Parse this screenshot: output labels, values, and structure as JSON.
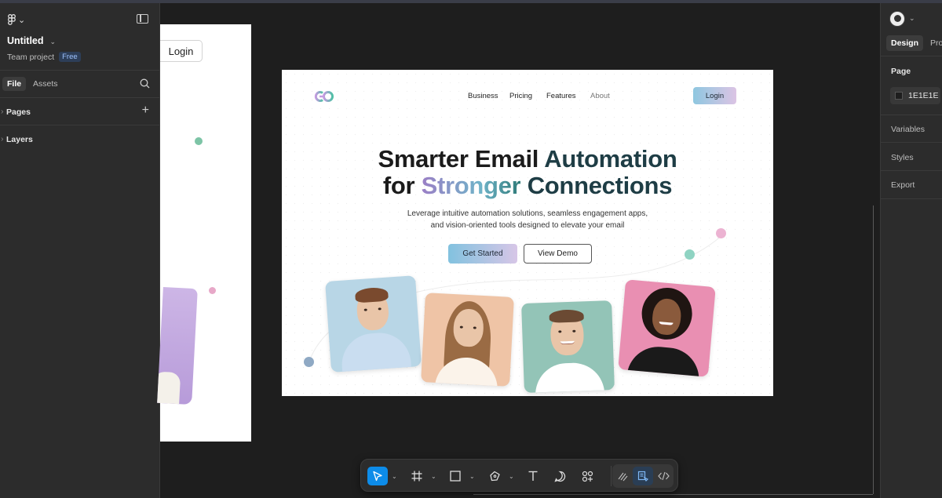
{
  "app": {
    "file_title": "Untitled",
    "team": "Team project",
    "plan_badge": "Free",
    "tabs": {
      "file": "File",
      "assets": "Assets"
    },
    "sections": {
      "pages": "Pages",
      "layers": "Layers"
    }
  },
  "right_panel": {
    "tabs": {
      "design": "Design",
      "prototype": "Pro"
    },
    "page_label": "Page",
    "page_color_hex": "1E1E1E",
    "page_color": "#1e1e1e",
    "variables": "Variables",
    "styles": "Styles",
    "export": "Export"
  },
  "canvas": {
    "left_frame_login": "Login",
    "landing": {
      "nav": [
        "Business",
        "Pricing",
        "Features",
        "About"
      ],
      "login": "Login",
      "headline_1a": "Smarter Email ",
      "headline_1b": "Automation",
      "headline_2a": "for ",
      "headline_2b": "Stronger",
      "headline_2c": " Connections",
      "subtext_1": "Leverage intuitive automation solutions, seamless engagement apps,",
      "subtext_2": "and vision-oriented tools designed to elevate your email",
      "cta_primary": "Get Started",
      "cta_secondary": "View Demo"
    }
  },
  "toolbar": {
    "tools": [
      "move",
      "frame",
      "rectangle",
      "pen",
      "text",
      "comment",
      "actions",
      "draw",
      "dev-mode",
      "code"
    ],
    "active_tool": "move"
  },
  "colors": {
    "accent": "#0d8ce9",
    "panel": "#2c2c2c",
    "canvas": "#1e1e1e"
  }
}
